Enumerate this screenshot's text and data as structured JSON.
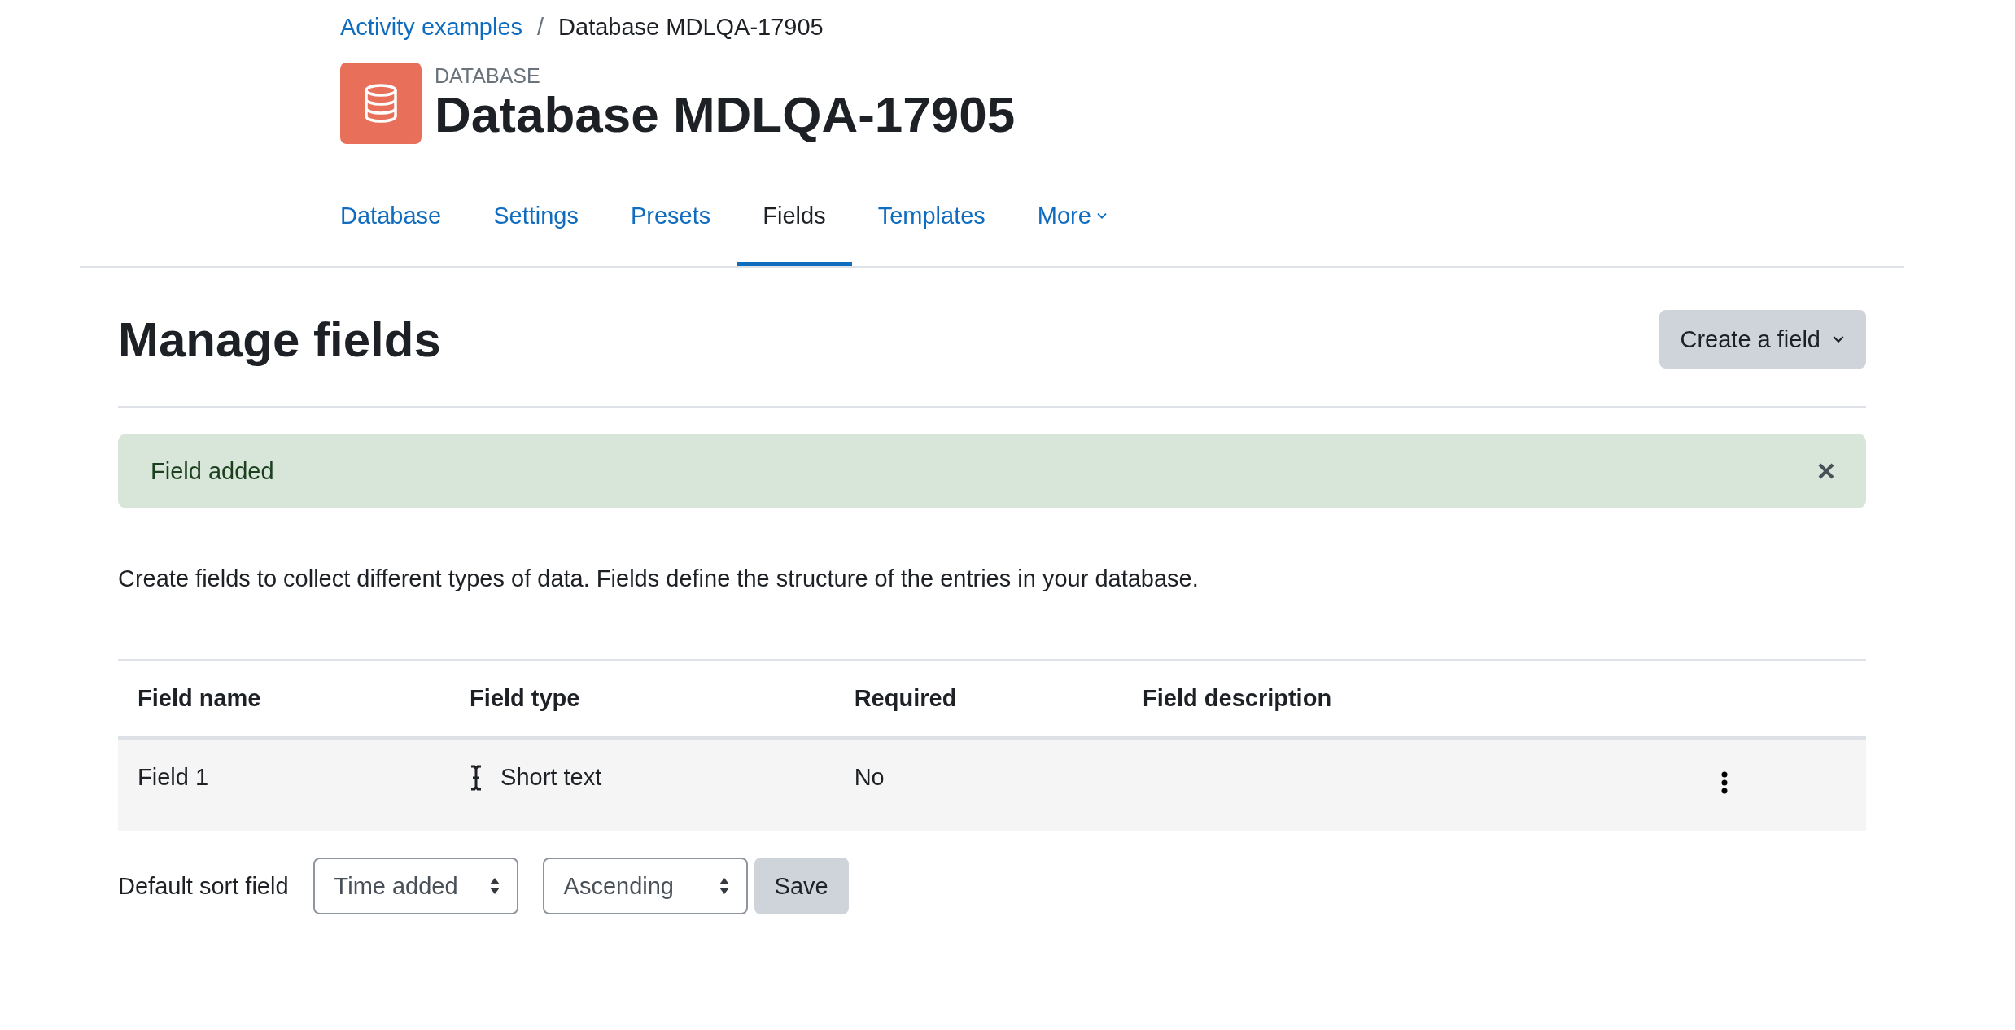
{
  "breadcrumb": [
    {
      "label": "Activity examples",
      "link": true
    },
    {
      "label": "Database MDLQA-17905",
      "link": false
    }
  ],
  "separator": "/",
  "header": {
    "kind_label": "DATABASE",
    "title": "Database MDLQA-17905"
  },
  "tabs": [
    {
      "label": "Database",
      "selected": false,
      "dropdown": false
    },
    {
      "label": "Settings",
      "selected": false,
      "dropdown": false
    },
    {
      "label": "Presets",
      "selected": false,
      "dropdown": false
    },
    {
      "label": "Fields",
      "selected": true,
      "dropdown": false
    },
    {
      "label": "Templates",
      "selected": false,
      "dropdown": false
    },
    {
      "label": "More",
      "selected": false,
      "dropdown": true
    }
  ],
  "page_title": "Manage fields",
  "create_button": "Create a field",
  "alert": {
    "message": "Field added"
  },
  "intro": "Create fields to collect different types of data. Fields define the structure of the entries in your database.",
  "table": {
    "columns": [
      "Field name",
      "Field type",
      "Required",
      "Field description"
    ],
    "rows": [
      {
        "name": "Field 1",
        "type": "Short text",
        "required": "No",
        "description": ""
      }
    ]
  },
  "sort": {
    "label": "Default sort field",
    "field": "Time added",
    "order": "Ascending",
    "save": "Save"
  }
}
